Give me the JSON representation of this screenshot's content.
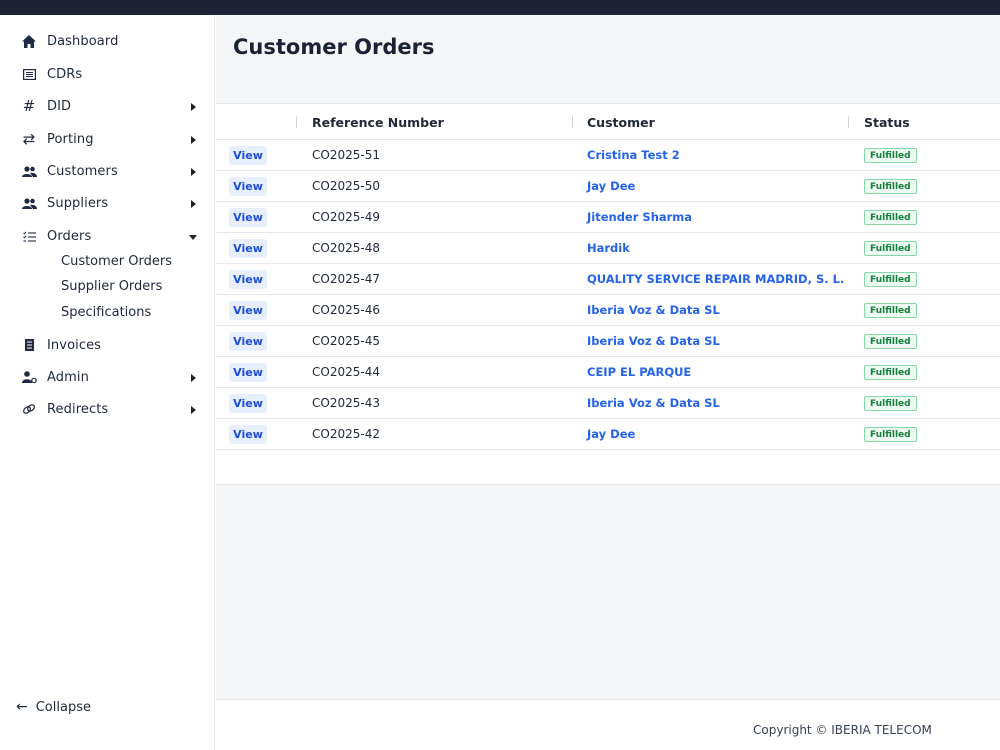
{
  "sidebar": {
    "items": [
      {
        "label": "Dashboard",
        "icon": "home-icon"
      },
      {
        "label": "CDRs",
        "icon": "list-icon"
      },
      {
        "label": "DID",
        "icon": "hash-icon"
      },
      {
        "label": "Porting",
        "icon": "swap-icon"
      },
      {
        "label": "Customers",
        "icon": "users-icon"
      },
      {
        "label": "Suppliers",
        "icon": "users-icon"
      },
      {
        "label": "Orders",
        "icon": "checklist-icon"
      },
      {
        "label": "Invoices",
        "icon": "invoice-icon"
      },
      {
        "label": "Admin",
        "icon": "user-gear-icon"
      },
      {
        "label": "Redirects",
        "icon": "link-icon"
      }
    ],
    "orders_sub": [
      "Customer Orders",
      "Supplier Orders",
      "Specifications"
    ],
    "collapse_label": "Collapse"
  },
  "main": {
    "title": "Customer Orders",
    "columns": [
      "Reference Number",
      "Customer",
      "Status"
    ],
    "view_label": "View",
    "rows": [
      {
        "ref": "CO2025-51",
        "customer": "Cristina Test 2",
        "status": "Fulfilled"
      },
      {
        "ref": "CO2025-50",
        "customer": "Jay Dee",
        "status": "Fulfilled"
      },
      {
        "ref": "CO2025-49",
        "customer": "Jitender Sharma",
        "status": "Fulfilled"
      },
      {
        "ref": "CO2025-48",
        "customer": "Hardik",
        "status": "Fulfilled"
      },
      {
        "ref": "CO2025-47",
        "customer": "QUALITY SERVICE REPAIR MADRID, S. L.",
        "status": "Fulfilled"
      },
      {
        "ref": "CO2025-46",
        "customer": "Iberia Voz & Data SL",
        "status": "Fulfilled"
      },
      {
        "ref": "CO2025-45",
        "customer": "Iberia Voz & Data SL",
        "status": "Fulfilled"
      },
      {
        "ref": "CO2025-44",
        "customer": "CEIP EL PARQUE",
        "status": "Fulfilled"
      },
      {
        "ref": "CO2025-43",
        "customer": "Iberia Voz & Data SL",
        "status": "Fulfilled"
      },
      {
        "ref": "CO2025-42",
        "customer": "Jay Dee",
        "status": "Fulfilled"
      }
    ]
  },
  "footer": {
    "copyright": "Copyright © IBERIA TELECOM"
  },
  "colors": {
    "topbar": "#1e2433",
    "link": "#2563eb",
    "status_green": "#15803d"
  }
}
